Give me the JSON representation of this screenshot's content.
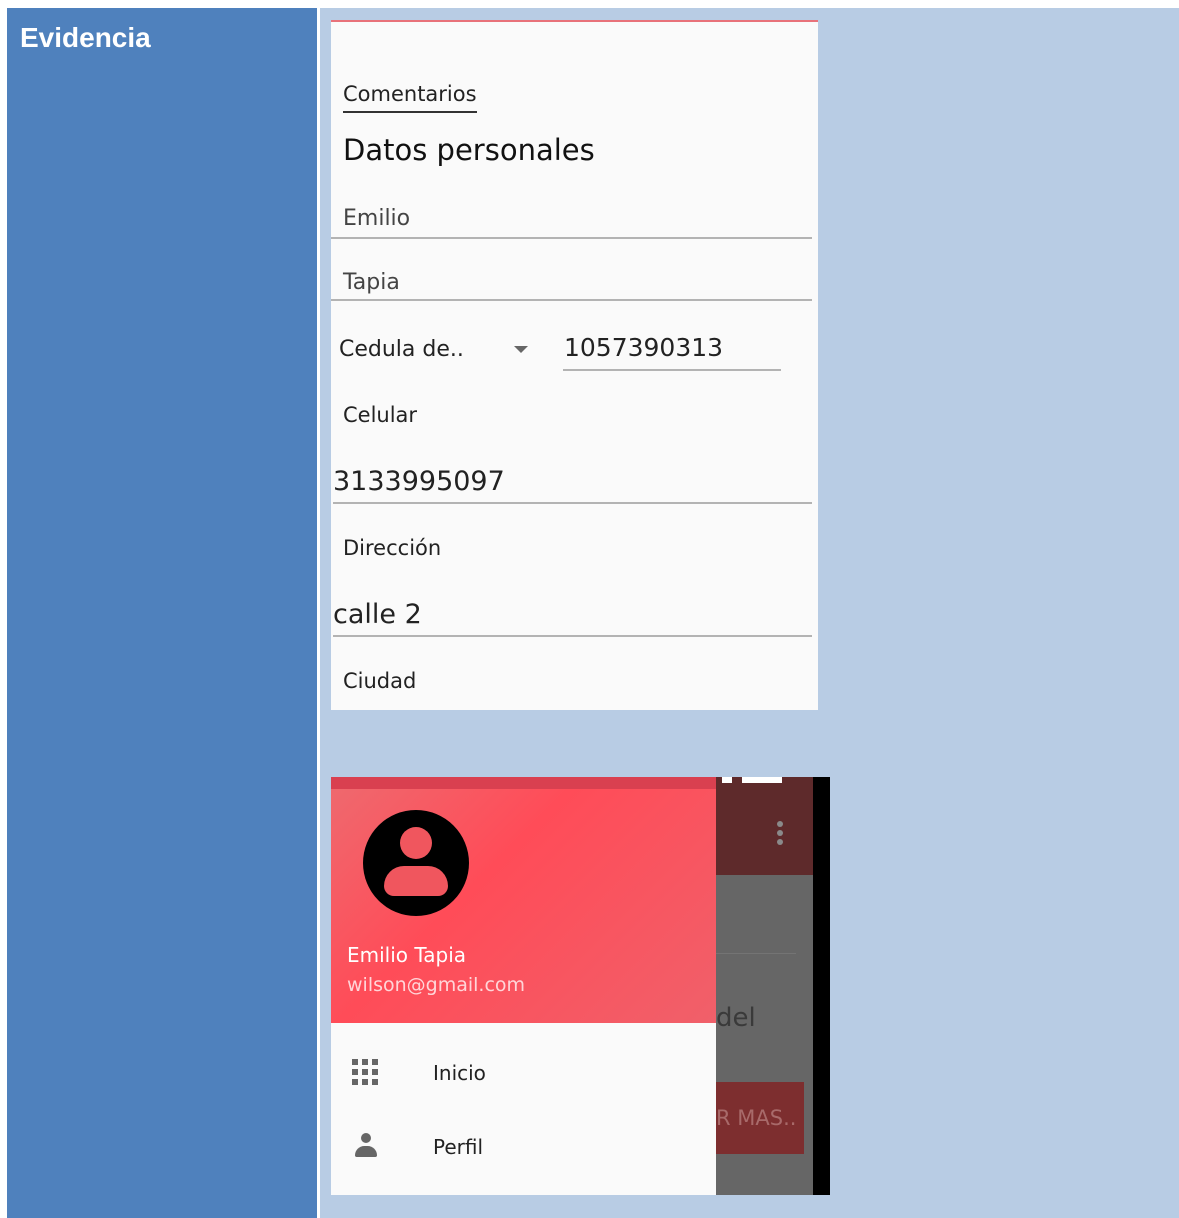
{
  "left_cell": {
    "title": "Evidencia"
  },
  "form": {
    "tab_label": "Comentarios",
    "section_title": "Datos personales",
    "first_name": "Emilio",
    "last_name": "Tapia",
    "id_type": "Cedula de..",
    "id_number": "1057390313",
    "phone_label": "Celular",
    "phone_value": "3133995097",
    "address_label": "Dirección",
    "address_value": "calle 2",
    "city_label": "Ciudad"
  },
  "drawer": {
    "user_name": "Emilio Tapia",
    "user_email": "wilson@gmail.com",
    "items": [
      {
        "label": "Inicio",
        "icon": "apps-grid-icon"
      },
      {
        "label": "Perfil",
        "icon": "person-icon"
      }
    ],
    "background_text": "del",
    "background_button": "R MAS.."
  },
  "colors": {
    "left_cell": "#4f81bd",
    "right_cell": "#b8cce4",
    "drawer_header": "#ff4c58"
  }
}
